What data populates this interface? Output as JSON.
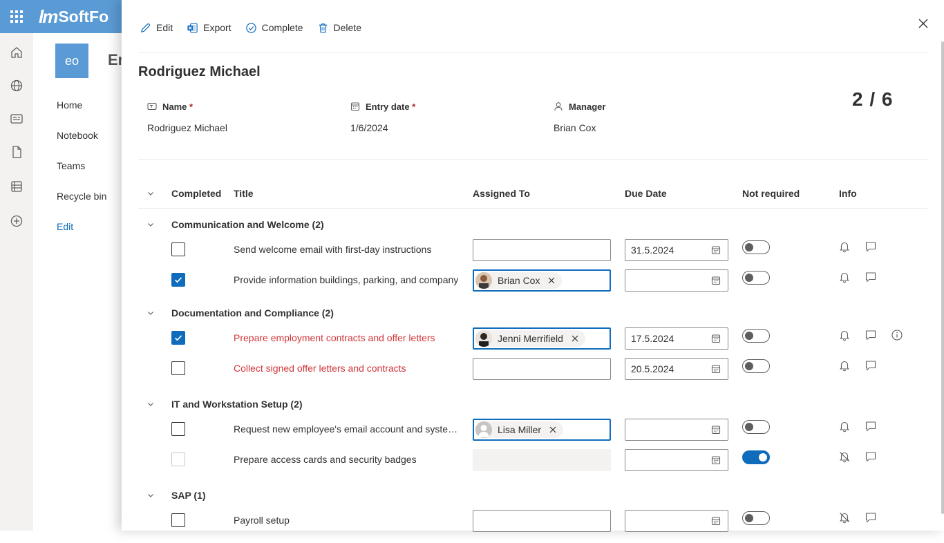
{
  "app": {
    "logo_text": "SoftFo",
    "logo_mark": "lm"
  },
  "site": {
    "logo_text": "eo",
    "title": "En",
    "nav": [
      {
        "label": "Home"
      },
      {
        "label": "Notebook"
      },
      {
        "label": "Teams"
      },
      {
        "label": "Recycle bin"
      },
      {
        "label": "Edit"
      }
    ]
  },
  "commands": {
    "edit": "Edit",
    "export": "Export",
    "complete": "Complete",
    "delete": "Delete"
  },
  "item": {
    "title": "Rodriguez Michael",
    "counter": "2 / 6",
    "fields": {
      "name": {
        "label": "Name",
        "required": "*",
        "value": "Rodriguez Michael"
      },
      "entry_date": {
        "label": "Entry date",
        "required": "*",
        "value": "1/6/2024"
      },
      "manager": {
        "label": "Manager",
        "value": "Brian Cox"
      }
    }
  },
  "grid": {
    "headers": {
      "completed": "Completed",
      "title": "Title",
      "assigned": "Assigned To",
      "due": "Due Date",
      "not_required": "Not required",
      "info": "Info"
    },
    "groups": [
      {
        "label": "Communication and Welcome (2)",
        "rows": [
          {
            "title": "Send welcome email with first-day instructions",
            "completed": false,
            "assigned": "",
            "due": "31.5.2024",
            "not_required": false
          },
          {
            "title": "Provide information buildings, parking, and company",
            "completed": true,
            "assigned": "Brian Cox",
            "due": "",
            "not_required": false
          }
        ]
      },
      {
        "label": "Documentation and Compliance (2)",
        "rows": [
          {
            "title": "Prepare employment contracts and offer letters",
            "completed": true,
            "assigned": "Jenni Merrifield",
            "due": "17.5.2024",
            "not_required": false
          },
          {
            "title": "Collect signed offer letters and contracts",
            "completed": false,
            "assigned": "",
            "due": "20.5.2024",
            "not_required": false
          }
        ]
      },
      {
        "label": "IT and Workstation Setup (2)",
        "rows": [
          {
            "title": "Request new employee's email account and system access",
            "completed": false,
            "assigned": "Lisa Miller",
            "due": "",
            "not_required": false
          },
          {
            "title": "Prepare access cards and security badges",
            "completed": false,
            "assigned": "",
            "due": "",
            "not_required": true
          }
        ]
      },
      {
        "label": "SAP (1)",
        "rows": [
          {
            "title": "Payroll setup",
            "completed": false,
            "assigned": "",
            "due": "",
            "not_required": false
          }
        ]
      }
    ]
  },
  "colors": {
    "brand": "#5b9bd5",
    "accent": "#0f6cbd",
    "danger_text": "#d13438"
  },
  "icons": [
    "waffle-icon",
    "home-icon",
    "globe-icon",
    "news-icon",
    "document-icon",
    "list-icon",
    "add-icon",
    "edit-icon",
    "excel-icon",
    "check-circle-icon",
    "trash-icon",
    "close-icon",
    "calendar-icon",
    "bell-icon",
    "bell-off-icon",
    "comment-icon",
    "info-icon"
  ]
}
